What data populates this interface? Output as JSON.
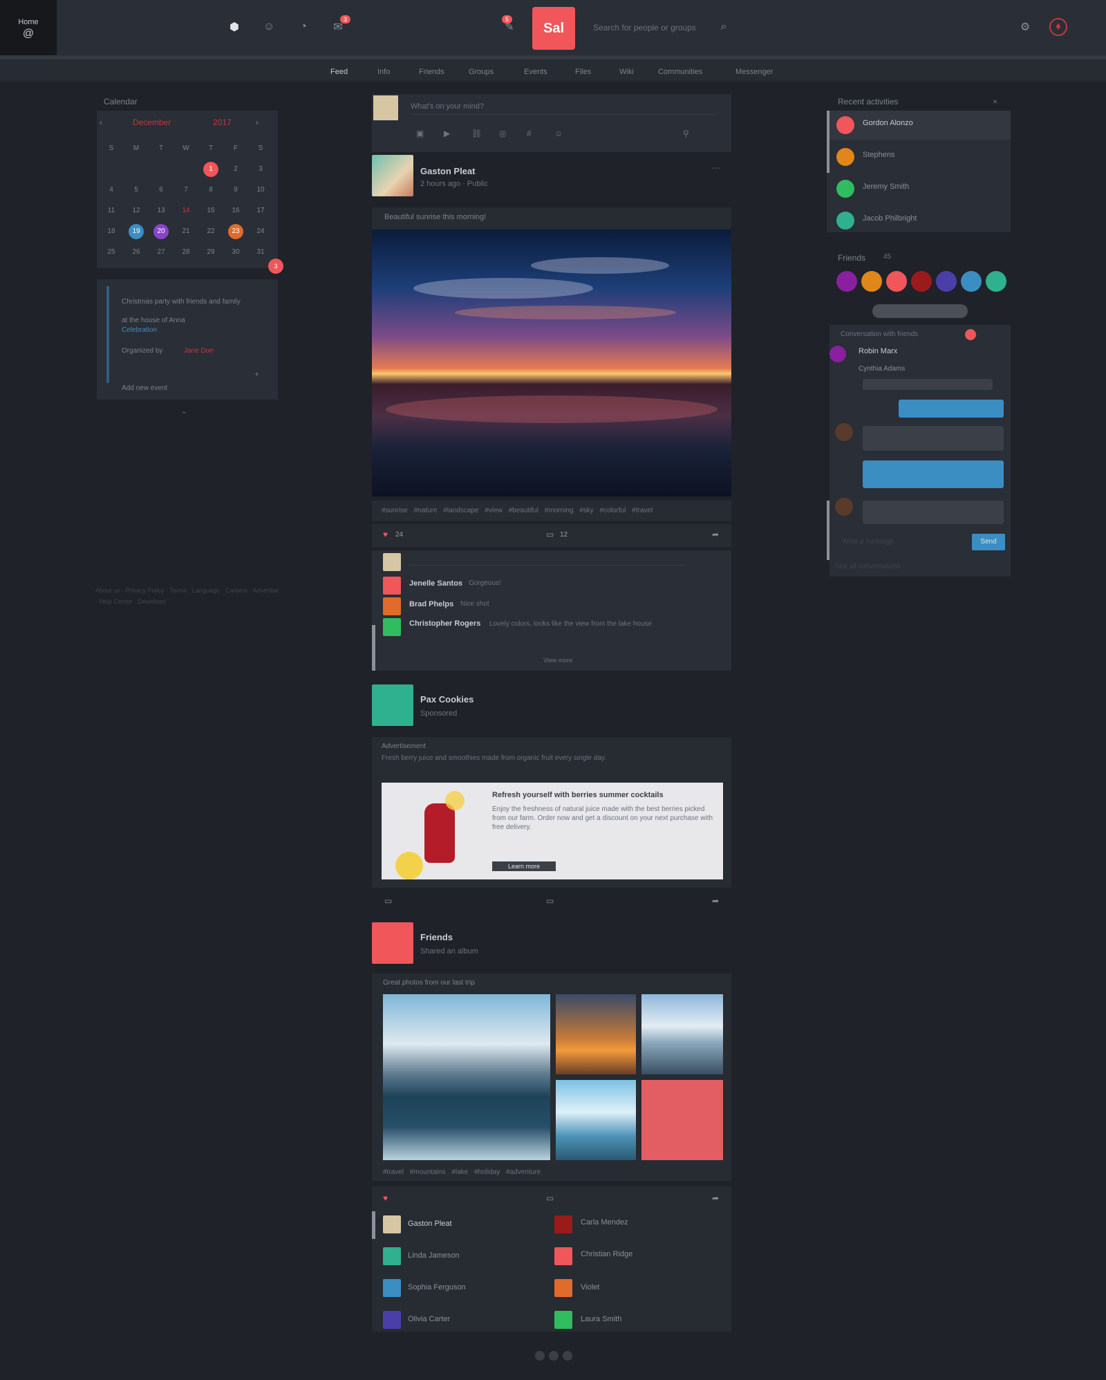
{
  "topbar": {
    "brand_label": "Home",
    "brand_sub": "@",
    "logo_text": "Sal",
    "search_placeholder": "Search for people or groups",
    "notif_badge": "3",
    "msg_badge": "5"
  },
  "subnav": {
    "items": [
      "Feed",
      "Info",
      "Friends",
      "Groups",
      "Events",
      "Files",
      "Wiki",
      "Communities",
      "Messenger"
    ]
  },
  "calendar": {
    "title": "Calendar",
    "month_label": "December",
    "year_label": "2017",
    "weekdays": [
      "S",
      "M",
      "T",
      "W",
      "T",
      "F",
      "S"
    ],
    "weeks": [
      [
        "",
        "",
        "",
        "",
        "1",
        "2",
        "3"
      ],
      [
        "4",
        "5",
        "6",
        "7",
        "8",
        "9",
        "10"
      ],
      [
        "11",
        "12",
        "13",
        "14",
        "15",
        "16",
        "17"
      ],
      [
        "18",
        "19",
        "20",
        "21",
        "22",
        "23",
        "24"
      ],
      [
        "25",
        "26",
        "27",
        "28",
        "29",
        "30",
        "31"
      ]
    ],
    "highlight_badge": "3",
    "event_line1": "Christmas party with friends and family",
    "event_line2": "at the house of Anna",
    "event_tag": "Celebration",
    "event_by": "Organized by",
    "event_by_name": "Jane Doe",
    "event_footer": "Add new event",
    "footer_links": [
      "About us",
      "Privacy Policy",
      "Terms",
      "Language",
      "Careers",
      "Advertise",
      "Help Center",
      "Download"
    ]
  },
  "composer": {
    "placeholder": "What's on your mind?"
  },
  "post1": {
    "name": "Gaston Pleat",
    "meta": "2 hours ago · Public",
    "text": "Beautiful sunrise this morning!",
    "tags": [
      "#sunrise",
      "#nature",
      "#landscape",
      "#view",
      "#beautiful",
      "#morning",
      "#sky",
      "#colorful",
      "#travel"
    ],
    "reactions": "24",
    "comments": "12",
    "comment1_name": "Jenelle Santos",
    "comment1_text": "Gorgeous!",
    "comment2_name": "Brad Phelps",
    "comment2_text": "Nice shot",
    "comment3_name": "Christopher Rogers",
    "comment3_text": "Lovely colors, looks like the view from the lake house",
    "more_comments": "View more"
  },
  "post2": {
    "name": "Pax Cookies",
    "meta": "Sponsored",
    "ad_label": "Advertisement",
    "ad_text": "Fresh berry juice and smoothies made from organic fruit every single day.",
    "ad_title": "Refresh yourself with berries summer cocktails",
    "ad_body": "Enjoy the freshness of natural juice made with the best berries picked from our farm. Order now and get a discount on your next purchase with free delivery.",
    "ad_button": "Learn more"
  },
  "post3": {
    "name": "Friends",
    "meta": "Shared an album",
    "text": "Great photos from our last trip",
    "tags": [
      "#travel",
      "#mountains",
      "#lake",
      "#holiday",
      "#adventure"
    ],
    "people": [
      "Gaston Pleat",
      "Linda Jameson",
      "Sophia Ferguson",
      "Olivia Carter",
      "Carla Mendez",
      "Christian Ridge",
      "Violet",
      "Laura Smith"
    ]
  },
  "sidebar_right": {
    "title": "Recent activities",
    "activities": [
      "Gordon Alonzo",
      "Stephens",
      "Jeremy Smith",
      "Jacob Philbright"
    ],
    "friends_title": "Friends",
    "friends_count": "45",
    "chat_title": "Conversation with friends",
    "chat_contacts": [
      "Robin Marx",
      "Cynthia Adams"
    ],
    "chat_input_placeholder": "Write a message",
    "send_label": "Send",
    "footer": "See all conversations"
  },
  "colors": {
    "accent": "#f0565a",
    "teal": "#2fb08f",
    "blue": "#3b8ec2",
    "bg": "#1f2228",
    "panel": "#2a2e36"
  }
}
